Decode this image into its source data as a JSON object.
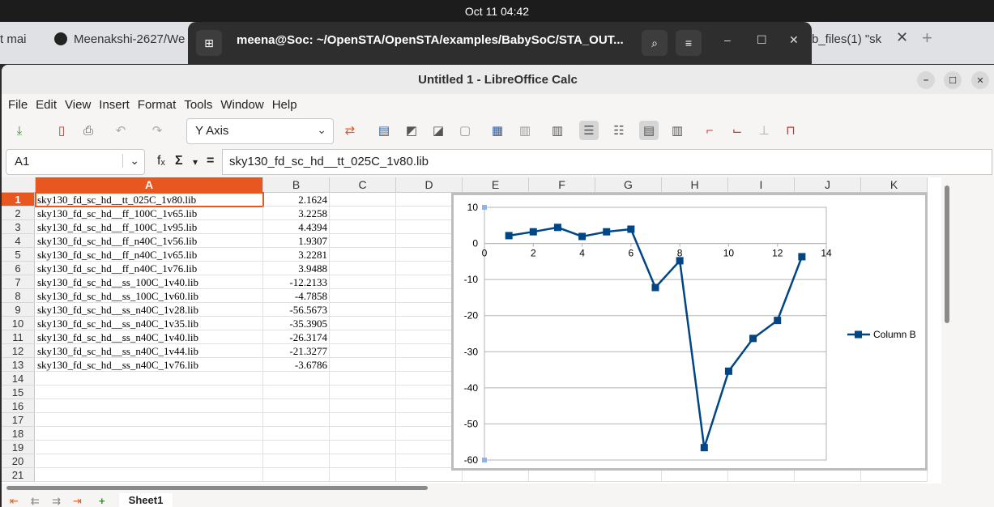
{
  "topbar": {
    "clock": "Oct 11  04:42"
  },
  "browser": {
    "tab_left_partial": "t mai",
    "tab_github": "Meenakshi-2627/We",
    "tab_right_partial": "b_files(1) \"sk",
    "close_glyph": "✕",
    "plus_glyph": "+"
  },
  "terminal": {
    "title": "meena@Soc: ~/OpenSTA/OpenSTA/examples/BabySoC/STA_OUT...",
    "new_tab_icon": "⊞",
    "search_icon": "⌕",
    "menu_icon": "≡",
    "min_glyph": "–",
    "max_glyph": "☐",
    "close_glyph": "✕"
  },
  "window": {
    "title": "Untitled 1 - LibreOffice Calc",
    "min_glyph": "–",
    "max_glyph": "☐",
    "close_glyph": "✕"
  },
  "menu": [
    "File",
    "Edit",
    "View",
    "Insert",
    "Format",
    "Tools",
    "Window",
    "Help"
  ],
  "toolbar": {
    "element_combo": "Y Axis",
    "caret": "⌄"
  },
  "formula_bar": {
    "name_box": "A1",
    "caret": "⌄",
    "fx": "fₓ",
    "sigma": "Σ",
    "sigma_caret": "▾",
    "equals": "=",
    "content": "sky130_fd_sc_hd__tt_025C_1v80.lib"
  },
  "sheet": {
    "columns": [
      "A",
      "B",
      "C",
      "D",
      "E",
      "F",
      "G",
      "H",
      "I",
      "J",
      "K"
    ],
    "row_numbers": [
      "1",
      "2",
      "3",
      "4",
      "5",
      "6",
      "7",
      "8",
      "9",
      "10",
      "11",
      "12",
      "13",
      "14",
      "15",
      "16",
      "17",
      "18",
      "19",
      "20",
      "21"
    ],
    "rows": [
      {
        "a": "sky130_fd_sc_hd__tt_025C_1v80.lib",
        "b": "2.1624"
      },
      {
        "a": "sky130_fd_sc_hd__ff_100C_1v65.lib",
        "b": "3.2258"
      },
      {
        "a": "sky130_fd_sc_hd__ff_100C_1v95.lib",
        "b": "4.4394"
      },
      {
        "a": "sky130_fd_sc_hd__ff_n40C_1v56.lib",
        "b": "1.9307"
      },
      {
        "a": "sky130_fd_sc_hd__ff_n40C_1v65.lib",
        "b": "3.2281"
      },
      {
        "a": "sky130_fd_sc_hd__ff_n40C_1v76.lib",
        "b": "3.9488"
      },
      {
        "a": "sky130_fd_sc_hd__ss_100C_1v40.lib",
        "b": "-12.2133"
      },
      {
        "a": "sky130_fd_sc_hd__ss_100C_1v60.lib",
        "b": "-4.7858"
      },
      {
        "a": "sky130_fd_sc_hd__ss_n40C_1v28.lib",
        "b": "-56.5673"
      },
      {
        "a": "sky130_fd_sc_hd__ss_n40C_1v35.lib",
        "b": "-35.3905"
      },
      {
        "a": "sky130_fd_sc_hd__ss_n40C_1v40.lib",
        "b": "-26.3174"
      },
      {
        "a": "sky130_fd_sc_hd__ss_n40C_1v44.lib",
        "b": "-21.3277"
      },
      {
        "a": "sky130_fd_sc_hd__ss_n40C_1v76.lib",
        "b": "-3.6786"
      }
    ]
  },
  "bottom": {
    "sheet_tab": "Sheet1",
    "nav_first": "⇤",
    "nav_prev": "⇇",
    "nav_next": "⇉",
    "nav_last": "⇥",
    "add_sheet": "+"
  },
  "colors": {
    "series": "#004586",
    "selection": "#e8571f"
  },
  "chart_data": {
    "type": "line",
    "x": [
      1,
      2,
      3,
      4,
      5,
      6,
      7,
      8,
      9,
      10,
      11,
      12,
      13
    ],
    "series": [
      {
        "name": "Column B",
        "values": [
          2.1624,
          3.2258,
          4.4394,
          1.9307,
          3.2281,
          3.9488,
          -12.2133,
          -4.7858,
          -56.5673,
          -35.3905,
          -26.3174,
          -21.3277,
          -3.6786
        ]
      }
    ],
    "xlim": [
      0,
      14
    ],
    "ylim": [
      -60,
      10
    ],
    "xticks": [
      "0",
      "2",
      "4",
      "6",
      "8",
      "10",
      "12",
      "14"
    ],
    "yticks": [
      "10",
      "0",
      "-10",
      "-20",
      "-30",
      "-40",
      "-50",
      "-60"
    ],
    "grid": true,
    "legend": "right",
    "markers": "square"
  }
}
